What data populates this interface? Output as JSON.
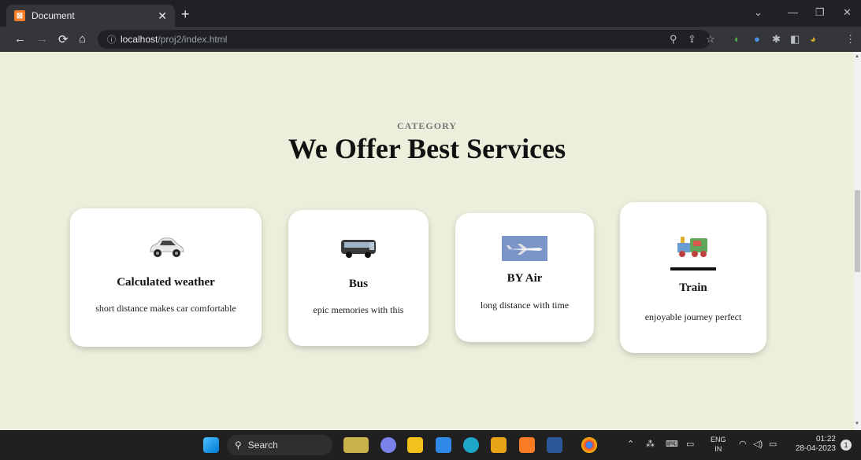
{
  "browser": {
    "tab_title": "Document",
    "tab_close": "✕",
    "new_tab": "+",
    "url_host": "localhost",
    "url_path": "/proj2/index.html"
  },
  "page": {
    "category": "CATEGORY",
    "heading": "We Offer Best Services",
    "cards": [
      {
        "title": "Calculated weather",
        "desc": "short distance makes car comfortable",
        "icon": "car-icon"
      },
      {
        "title": "Bus",
        "desc": "epic memories with this",
        "icon": "bus-icon"
      },
      {
        "title": "BY Air",
        "desc": "long distance with time",
        "icon": "airplane-icon"
      },
      {
        "title": "Train",
        "desc": "enjoyable journey perfect",
        "icon": "train-icon"
      }
    ]
  },
  "taskbar": {
    "search_label": "Search",
    "lang_top": "ENG",
    "lang_bottom": "IN",
    "time": "01:22",
    "date": "28-04-2023",
    "notif_count": "1"
  }
}
